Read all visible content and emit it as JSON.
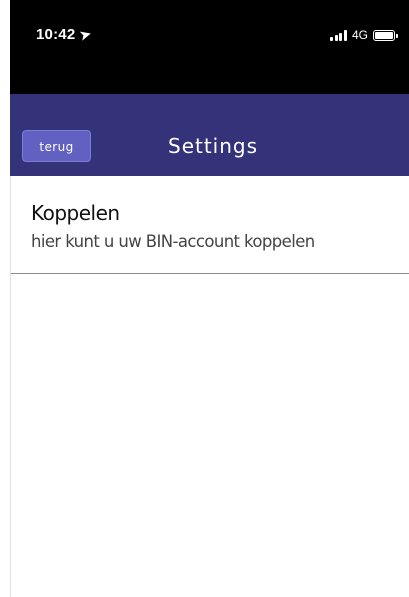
{
  "status_bar": {
    "time": "10:42",
    "location_icon": "location-arrow-icon",
    "network": "4G",
    "signal_icon": "cellular-signal-icon",
    "battery_icon": "battery-icon"
  },
  "header": {
    "back_label": "terug",
    "title": "Settings",
    "background_color": "#34337a",
    "button_color": "#6261c2"
  },
  "settings": {
    "items": [
      {
        "title": "Koppelen",
        "subtitle": "hier kunt u uw BIN-account koppelen"
      }
    ]
  }
}
